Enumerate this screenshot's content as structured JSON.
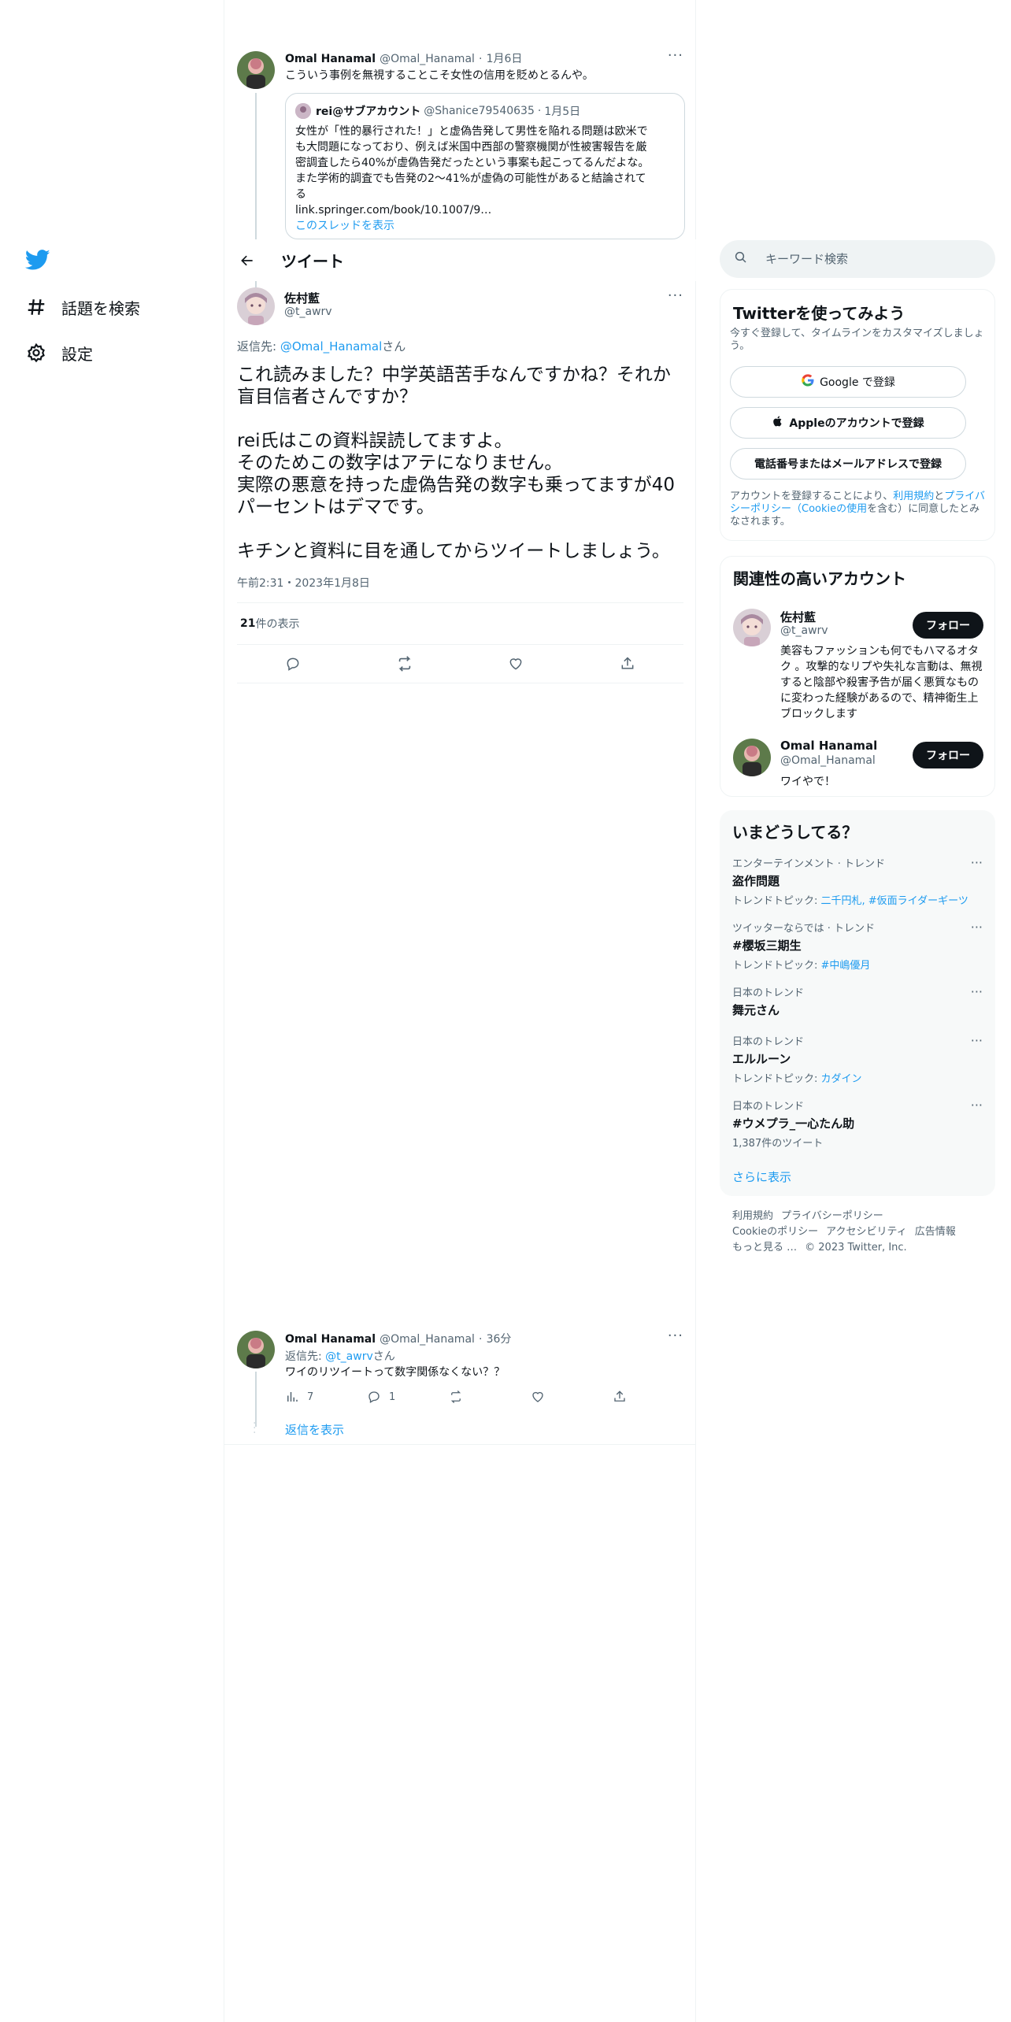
{
  "colors": {
    "accent": "#1d9bf0",
    "text": "#0f1419",
    "muted": "#536471",
    "border": "#eff3f4"
  },
  "nav": {
    "logo": "twitter-bird-icon",
    "items": [
      {
        "icon": "hashtag-icon",
        "label": "話題を検索"
      },
      {
        "icon": "gear-icon",
        "label": "設定"
      }
    ]
  },
  "header": {
    "title": "ツイート"
  },
  "parent_tweet": {
    "name": "Omal Hanamal",
    "handle": "@Omal_Hanamal",
    "sep": "·",
    "date": "1月6日",
    "text": "こういう事例を無視することこそ女性の信用を貶めとるんや。",
    "quote": {
      "name": "rei@サブアカウント",
      "handle": "@Shanice79540635",
      "date": "1月5日",
      "text_lines": [
        "女性が「性的暴行された！」と虚偽告発して男性を陥れる問題は欧米で",
        "も大問題になっており、例えば米国中西部の警察機関が性被害報告を厳",
        "密調査したら40%が虚偽告発だったという事案も起こってるんだよな。",
        "また学術的調査でも告発の2〜41%が虚偽の可能性があると結論されて",
        "る",
        "link.springer.com/book/10.1007/9…"
      ],
      "show_thread": "このスレッドを表示"
    }
  },
  "main_tweet": {
    "name": "佐村藍",
    "handle": "@t_awrv",
    "reply_prefix": "返信先: ",
    "reply_to": "@Omal_Hanamal",
    "reply_suffix": "さん",
    "text": "これ読みました？中学英語苦手なんですかね？それか盲目信者さんですか？\n\nrei氏はこの資料誤読してますよ。\nそのためこの数字はアテになりません。\n実際の悪意を持った虚偽告発の数字も乗ってますが40パーセントはデマです。\n\nキチンと資料に目を通してからツイートしましょう。",
    "timestamp": "午前2:31・2023年1月8日",
    "views_count": "21",
    "views_label": " 件の表示"
  },
  "reply_tweet": {
    "name": "Omal Hanamal",
    "handle": "@Omal_Hanamal",
    "sep": "·",
    "date": "36分",
    "reply_prefix": "返信先: ",
    "reply_to": "@t_awrv",
    "reply_suffix": "さん",
    "text": "ワイのリツイートって数字関係なくない？？",
    "views": "7",
    "replies": "1",
    "show_replies": "返信を表示"
  },
  "search": {
    "placeholder": "キーワード検索"
  },
  "signup": {
    "title": "Twitterを使ってみよう",
    "subtitle": "今すぐ登録して、タイムラインをカスタマイズしましょう。",
    "google": "Google で登録",
    "apple": "Appleのアカウントで登録",
    "phone": "電話番号またはメールアドレスで登録",
    "terms_1": "アカウントを登録することにより、",
    "terms_link1": "利用規約",
    "terms_2": "と",
    "terms_link2": "プライバシーポリシー（Cookieの使用",
    "terms_3": "を含む）に同意したとみなされます。"
  },
  "related": {
    "title": "関連性の高いアカウント",
    "accounts": [
      {
        "name": "佐村藍",
        "handle": "@t_awrv",
        "bio": "美容もファッションも何でもハマるオタク 。攻撃的なリプや失礼な言動は、無視すると陰部や殺害予告が届く悪質なものに変わった経験があるので、精神衛生上ブロックします",
        "follow": "フォロー"
      },
      {
        "name": "Omal Hanamal",
        "handle": "@Omal_Hanamal",
        "bio": "ワイやで！",
        "follow": "フォロー"
      }
    ]
  },
  "trends": {
    "title": "いまどうしてる？",
    "items": [
      {
        "context": "エンターテインメント · トレンド",
        "name": "盗作問題",
        "sub_prefix": "トレンドトピック: ",
        "sub_links": "二千円札, #仮面ライダーギーツ"
      },
      {
        "context": "ツイッターならでは · トレンド",
        "name": "#櫻坂三期生",
        "sub_prefix": "トレンドトピック: ",
        "sub_links": "#中嶋優月"
      },
      {
        "context": "日本のトレンド",
        "name": "舞元さん",
        "sub_prefix": "",
        "sub_links": ""
      },
      {
        "context": "日本のトレンド",
        "name": "エルルーン",
        "sub_prefix": "トレンドトピック: ",
        "sub_links": "カダイン"
      },
      {
        "context": "日本のトレンド",
        "name": "#ウメプラ_一心たん助",
        "sub_prefix": "1,387件のツイート",
        "sub_links": ""
      }
    ],
    "show_more": "さらに表示"
  },
  "footer": {
    "links": [
      "利用規約",
      "プライバシーポリシー",
      "Cookieのポリシー",
      "アクセシビリティ",
      "広告情報",
      "もっと見る …",
      "© 2023 Twitter, Inc."
    ]
  }
}
